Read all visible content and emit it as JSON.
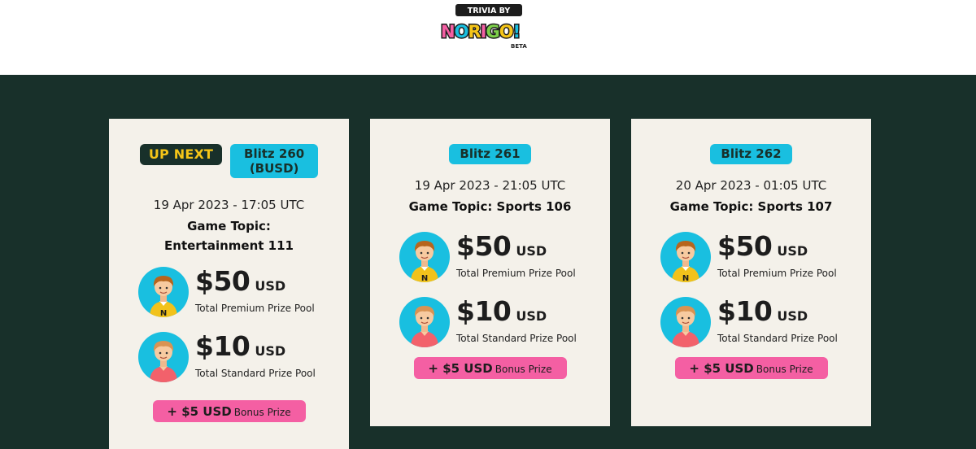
{
  "header": {
    "logo": {
      "top_text": "TRIVIA BY",
      "brand_text": "NORIGO!",
      "badge_text": "BETA"
    }
  },
  "colors": {
    "main_bg": "#18302a",
    "card_bg": "#f4f1ea",
    "accent_blue": "#19bfe0",
    "accent_pink": "#f45fa3",
    "accent_yellow": "#f5c518"
  },
  "cards": [
    {
      "up_next": "UP NEXT",
      "blitz": "Blitz 260 (BUSD)",
      "date": "19 Apr 2023 - 17:05 UTC",
      "topic": "Game Topic: Entertainment 111",
      "premium": {
        "amount": "$50",
        "currency": "USD",
        "label": "Total Premium Prize Pool",
        "icon": "premium-player-avatar-icon"
      },
      "standard": {
        "amount": "$10",
        "currency": "USD",
        "label": "Total Standard Prize Pool",
        "icon": "standard-player-avatar-icon"
      },
      "bonus": {
        "amount": "+ $5 USD",
        "label": "Bonus Prize"
      }
    },
    {
      "blitz": "Blitz 261",
      "date": "19 Apr 2023 - 21:05 UTC",
      "topic": "Game Topic: Sports 106",
      "premium": {
        "amount": "$50",
        "currency": "USD",
        "label": "Total Premium Prize Pool",
        "icon": "premium-player-avatar-icon"
      },
      "standard": {
        "amount": "$10",
        "currency": "USD",
        "label": "Total Standard Prize Pool",
        "icon": "standard-player-avatar-icon"
      },
      "bonus": {
        "amount": "+ $5 USD",
        "label": "Bonus Prize"
      }
    },
    {
      "blitz": "Blitz 262",
      "date": "20 Apr 2023 - 01:05 UTC",
      "topic": "Game Topic: Sports 107",
      "premium": {
        "amount": "$50",
        "currency": "USD",
        "label": "Total Premium Prize Pool",
        "icon": "premium-player-avatar-icon"
      },
      "standard": {
        "amount": "$10",
        "currency": "USD",
        "label": "Total Standard Prize Pool",
        "icon": "standard-player-avatar-icon"
      },
      "bonus": {
        "amount": "+ $5 USD",
        "label": "Bonus Prize"
      }
    }
  ]
}
